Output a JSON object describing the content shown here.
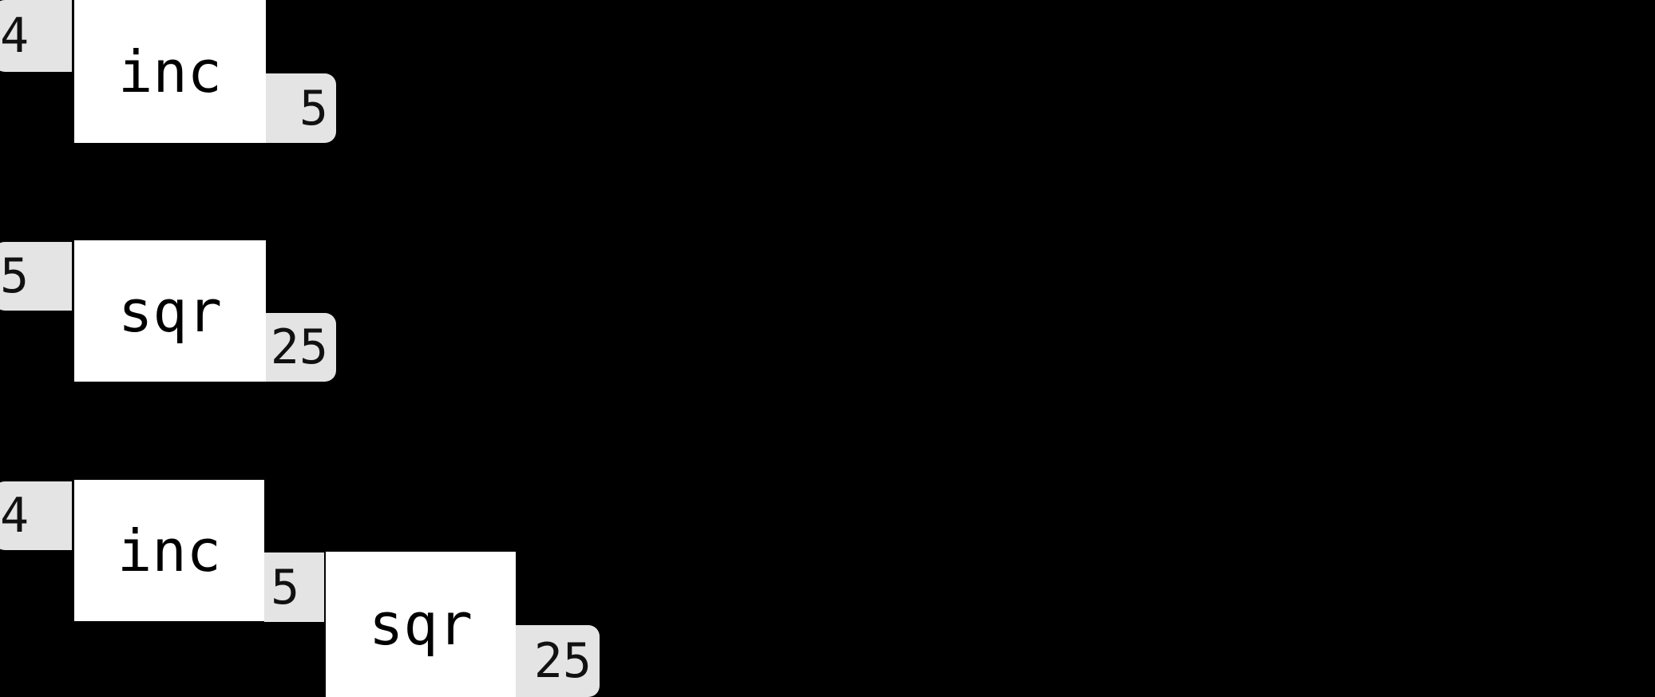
{
  "diagram": {
    "title": "function-application-boxes",
    "background_color": "#000000",
    "box_color": "#ffffff",
    "badge_color": "#e4e4e4",
    "text_color": "#000000",
    "rows": [
      {
        "id": "row-inc",
        "description": "inc applied to 4 yields 5",
        "nodes": [
          {
            "kind": "input-badge",
            "label": "4"
          },
          {
            "kind": "function-box",
            "label": "inc"
          },
          {
            "kind": "output-badge",
            "label": "5"
          }
        ]
      },
      {
        "id": "row-sqr",
        "description": "sqr applied to 5 yields 25",
        "nodes": [
          {
            "kind": "input-badge",
            "label": "5"
          },
          {
            "kind": "function-box",
            "label": "sqr"
          },
          {
            "kind": "output-badge",
            "label": "25"
          }
        ]
      },
      {
        "id": "row-composed",
        "description": "inc then sqr applied to 4 yields 25",
        "nodes": [
          {
            "kind": "input-badge",
            "label": "4"
          },
          {
            "kind": "function-box",
            "label": "inc"
          },
          {
            "kind": "middle-badge",
            "label": "5"
          },
          {
            "kind": "function-box",
            "label": "sqr"
          },
          {
            "kind": "output-badge",
            "label": "25"
          }
        ]
      }
    ]
  }
}
